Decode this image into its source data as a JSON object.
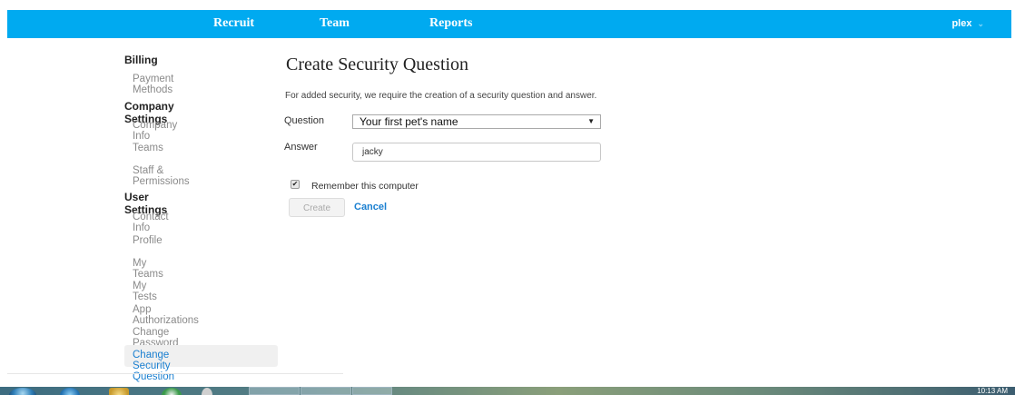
{
  "nav": {
    "links": [
      "Recruit",
      "Team",
      "Reports"
    ],
    "user": "plex",
    "accent_color": "#00aaf0"
  },
  "sidebar": {
    "sections": [
      {
        "heading": "Billing",
        "items": [
          "Payment Methods"
        ]
      },
      {
        "heading": "Company Settings",
        "items": [
          "Company Info",
          "Teams",
          "Staff & Permissions"
        ]
      },
      {
        "heading": "User Settings",
        "items": [
          "Contact Info",
          "Profile",
          "My Teams",
          "My Tests",
          "App Authorizations",
          "Change Password",
          "Change Security Question"
        ]
      }
    ],
    "active_item": "Change Security Question"
  },
  "main": {
    "title": "Create Security Question",
    "intro": "For added security, we require the creation of a security question and answer.",
    "question_label": "Question",
    "question_value": "Your first pet's name",
    "answer_label": "Answer",
    "answer_value": "jacky",
    "remember_label": "Remember this computer",
    "remember_checked": true,
    "create_label": "Create",
    "cancel_label": "Cancel"
  },
  "taskbar": {
    "clock": "10:13 AM",
    "icons": [
      "start-orb",
      "ie-icon",
      "folder-icon",
      "chrome-icon",
      "media-icon"
    ]
  }
}
